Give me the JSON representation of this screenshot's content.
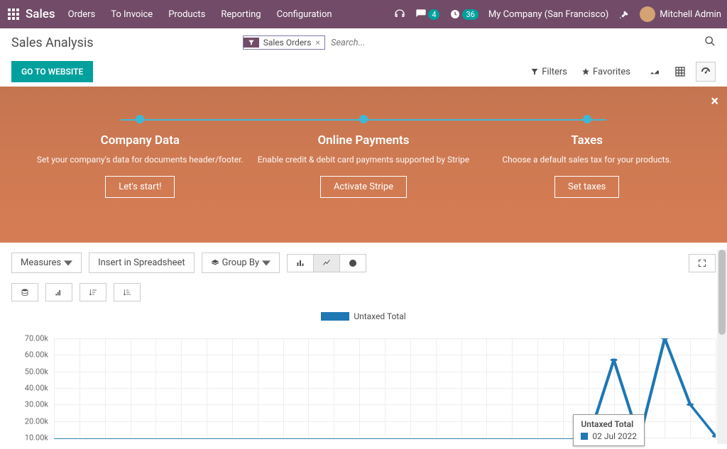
{
  "navbar": {
    "brand": "Sales",
    "menu": [
      "Orders",
      "To Invoice",
      "Products",
      "Reporting",
      "Configuration"
    ],
    "msg_badge": "4",
    "activity_badge": "36",
    "company": "My Company (San Francisco)",
    "user": "Mitchell Admin"
  },
  "page": {
    "title": "Sales Analysis",
    "filter_chip": "Sales Orders",
    "search_placeholder": "Search..."
  },
  "toolbar": {
    "go_website": "GO TO WEBSITE",
    "filters": "Filters",
    "favorites": "Favorites"
  },
  "banner": {
    "steps": [
      {
        "title": "Company Data",
        "desc": "Set your company's data for documents header/footer.",
        "action": "Let's start!"
      },
      {
        "title": "Online Payments",
        "desc": "Enable credit & debit card payments supported by Stripe",
        "action": "Activate Stripe"
      },
      {
        "title": "Taxes",
        "desc": "Choose a default sales tax for your products.",
        "action": "Set taxes"
      }
    ]
  },
  "chart_toolbar": {
    "measures": "Measures",
    "insert": "Insert in Spreadsheet",
    "group_by": "Group By"
  },
  "chart_data": {
    "type": "line",
    "title": "",
    "legend": "Untaxed Total",
    "ylabel": "",
    "ylim": [
      0,
      70000
    ],
    "y_ticks": [
      "70.00k",
      "60.00k",
      "50.00k",
      "40.00k",
      "30.00k",
      "20.00k",
      "10.00k"
    ],
    "series": [
      {
        "name": "Untaxed Total",
        "values": [
          0,
          0,
          0,
          0,
          0,
          0,
          0,
          0,
          0,
          0,
          0,
          0,
          0,
          0,
          0,
          0,
          0,
          0,
          0,
          0,
          0,
          0,
          55000,
          0,
          70000,
          24000,
          2000
        ]
      }
    ],
    "tooltip": {
      "title": "Untaxed Total",
      "date": "02 Jul 2022"
    }
  }
}
